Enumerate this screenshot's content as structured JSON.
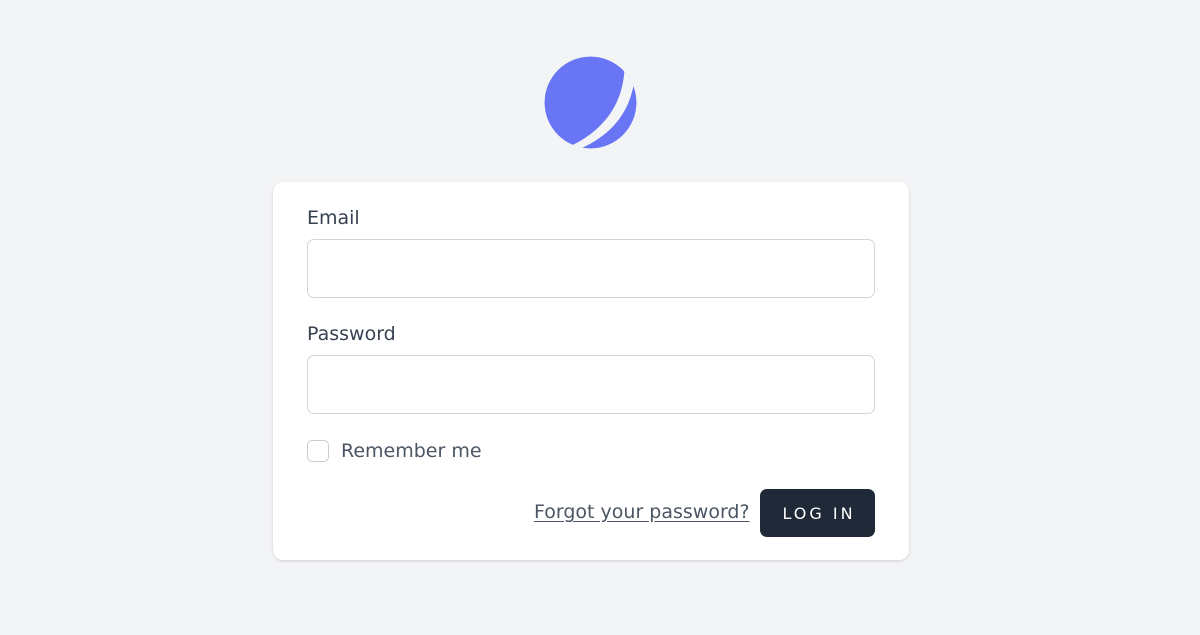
{
  "logo": {
    "icon": "app-logo-icon",
    "color": "#6875f5"
  },
  "form": {
    "email_label": "Email",
    "email_value": "",
    "email_placeholder": "",
    "password_label": "Password",
    "password_value": "",
    "password_placeholder": "",
    "remember_label": "Remember me",
    "remember_checked": false,
    "forgot_link": "Forgot your password?",
    "login_button": "LOG IN"
  },
  "colors": {
    "background": "#f3f4f6",
    "card": "#ffffff",
    "button": "#1f2937",
    "text": "#374151"
  }
}
